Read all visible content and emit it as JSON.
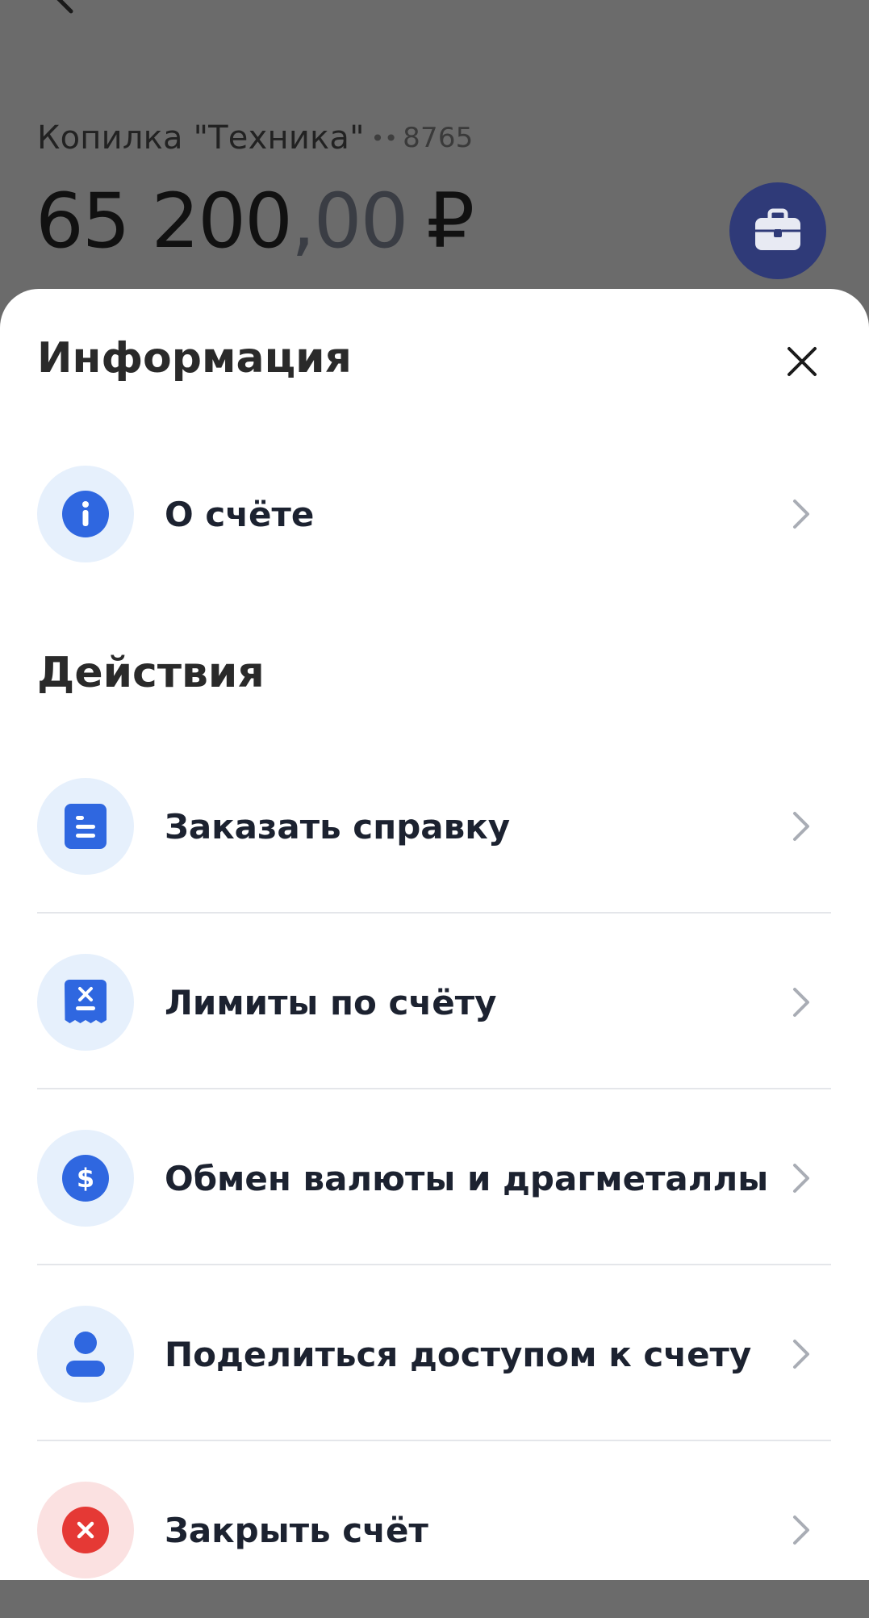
{
  "background": {
    "account_name": "Копилка \"Техника\"",
    "account_dots": "••",
    "account_number": "8765",
    "balance_main": "65 200",
    "balance_cents": ",00",
    "balance_currency": "₽"
  },
  "sheet": {
    "info_title": "Информация",
    "info_items": [
      {
        "label": "О счёте",
        "icon": "info-icon"
      }
    ],
    "actions_title": "Действия",
    "action_items": [
      {
        "label": "Заказать справку",
        "icon": "document-icon"
      },
      {
        "label": "Лимиты по счёту",
        "icon": "receipt-limit-icon"
      },
      {
        "label": "Обмен валюты и драгметаллы",
        "icon": "dollar-icon"
      },
      {
        "label": "Поделиться доступом к счету",
        "icon": "person-icon"
      },
      {
        "label": "Закрыть счёт",
        "icon": "close-account-icon"
      }
    ]
  },
  "colors": {
    "accent": "#2f67e0",
    "icon_bg": "#e6f0fc",
    "danger": "#e53935",
    "danger_bg": "#fbe1e1",
    "overlay": "#6b6b6b",
    "briefcase_bg": "#2f3a78"
  }
}
